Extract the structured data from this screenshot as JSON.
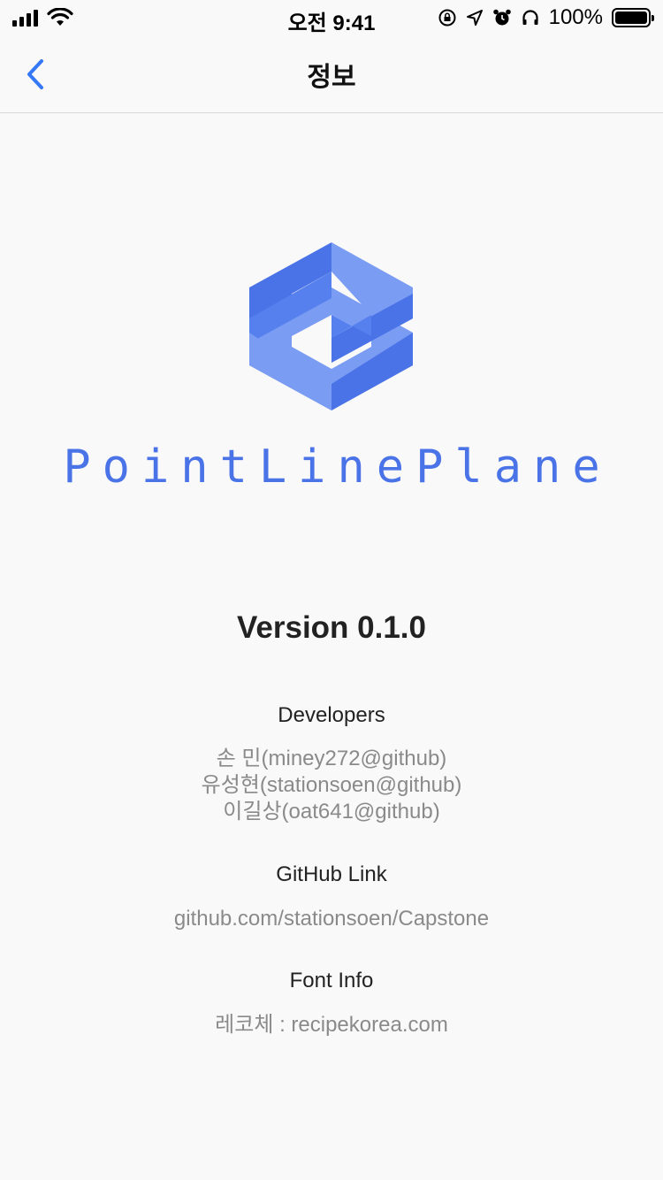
{
  "status_bar": {
    "time": "오전 9:41",
    "battery_percent": "100%",
    "battery_level": 1.0
  },
  "nav": {
    "title": "정보"
  },
  "app": {
    "name": "PointLinePlane",
    "version": "Version 0.1.0",
    "accent_color": "#4a73e8"
  },
  "developers": {
    "heading": "Developers",
    "names": [
      "손  민(miney272@github)",
      "유성현(stationsoen@github)",
      "이길상(oat641@github)"
    ]
  },
  "github": {
    "heading": "GitHub Link",
    "link": "github.com/stationsoen/Capstone"
  },
  "font_info": {
    "heading": "Font Info",
    "text": "레코체 : recipekorea.com"
  }
}
